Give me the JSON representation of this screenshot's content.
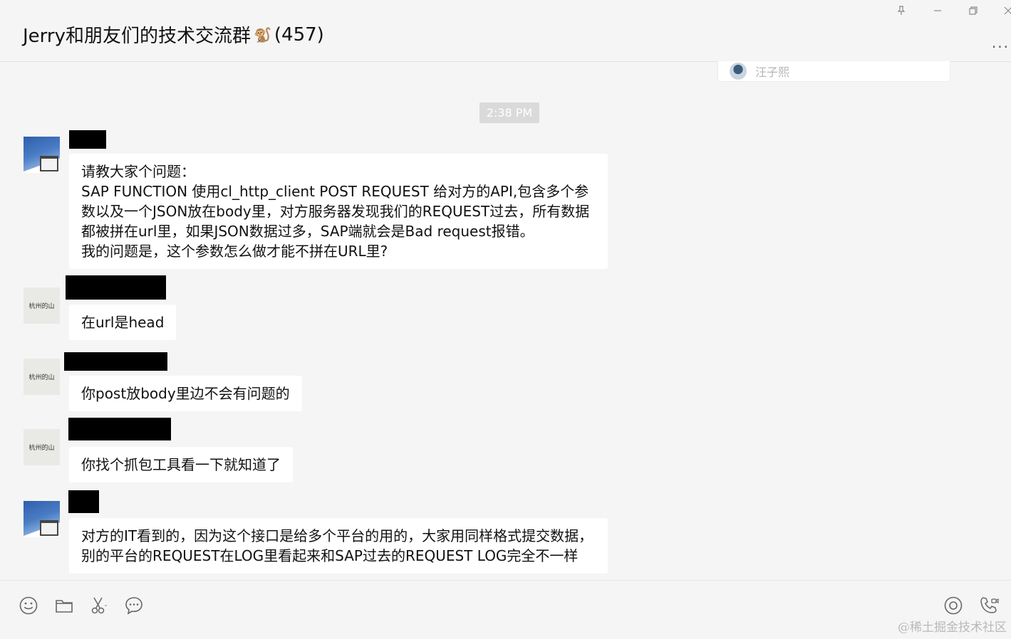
{
  "window": {
    "title": "Jerry和朋友们的技术交流群",
    "title_emoji": "🐒",
    "member_count": "(457)",
    "controls": {
      "pin_icon": "pin-icon",
      "minimize_icon": "minimize-icon",
      "restore_icon": "restore-icon",
      "close_icon": "close-icon"
    },
    "more_label": "..."
  },
  "mention_popup": {
    "name": "汪子熙"
  },
  "chat": {
    "timestamp": "2:38 PM",
    "messages": [
      {
        "avatar": "sky",
        "text": "请教大家个问题：\nSAP FUNCTION 使用cl_http_client POST REQUEST 给对方的API,包含多个参数以及一个JSON放在body里，对方服务器发现我们的REQUEST过去，所有数据都被拼在url里，如果JSON数据过多，SAP端就会是Bad request报错。\n我的问题是，这个参数怎么做才能不拼在URL里?"
      },
      {
        "avatar": "paper",
        "avatar_text": "杭州的山",
        "text": "在url是head"
      },
      {
        "avatar": "paper",
        "avatar_text": "杭州的山",
        "text": "你post放body里边不会有问题的"
      },
      {
        "avatar": "paper",
        "avatar_text": "杭州的山",
        "text": "你找个抓包工具看一下就知道了"
      },
      {
        "avatar": "sky",
        "text": "对方的IT看到的，因为这个接口是给多个平台的用的，大家用同样格式提交数据，别的平台的REQUEST在LOG里看起来和SAP过去的REQUEST LOG完全不一样"
      }
    ]
  },
  "toolbar": {
    "left_icons": [
      "emoji-icon",
      "folder-icon",
      "scissors-icon",
      "chat-history-icon"
    ],
    "right_icons": [
      "live-icon",
      "call-icon"
    ]
  },
  "watermark": "@稀土掘金技术社区"
}
